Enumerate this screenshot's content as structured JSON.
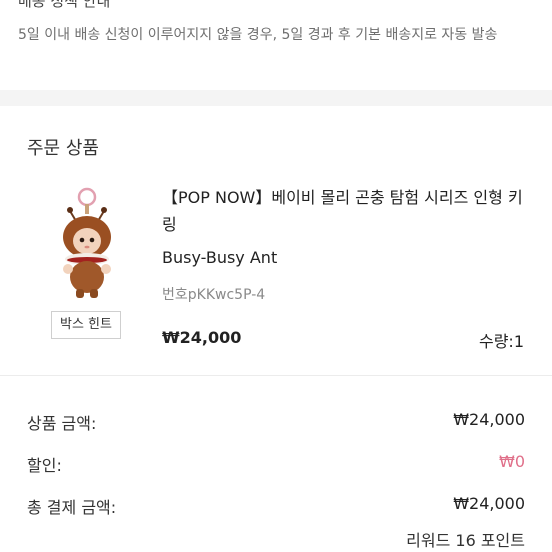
{
  "shipping_notice": {
    "cut_title": "배송 정책 안내",
    "text": "5일 이내 배송 신청이 이루어지지 않을 경우, 5일 경과 후 기본 배송지로 자동 발송"
  },
  "order": {
    "section_title": "주문 상품",
    "product": {
      "name": "【POP NOW】베이비 몰리 곤충 탐험 시리즈 인형 키링",
      "option": "Busy-Busy Ant",
      "code": "번호pKKwc5P-4",
      "price": "₩24,000",
      "quantity": "수량:1",
      "box_hint_label": "박스 힌트",
      "image_icon": "keychain-doll-image"
    }
  },
  "summary": {
    "product_amount_label": "상품 금액:",
    "product_amount": "₩24,000",
    "discount_label": "할인:",
    "discount": "₩0",
    "total_label": "총 결제 금액:",
    "total": "₩24,000",
    "reward": "리워드 16 포인트"
  },
  "colors": {
    "discount": "#e0708a",
    "band": "#f4f4f4"
  }
}
